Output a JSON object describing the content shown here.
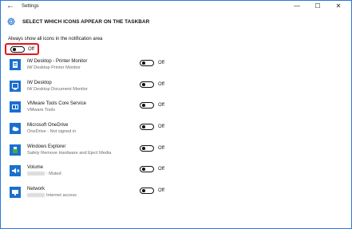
{
  "window": {
    "title": "Settings",
    "back_glyph": "←",
    "minimize_glyph": "—",
    "maximize_glyph": "☐",
    "close_glyph": "✕"
  },
  "page": {
    "title": "SELECT WHICH ICONS APPEAR ON THE TASKBAR",
    "title_icon": "gear-icon"
  },
  "always_show": {
    "label": "Always show all icons in the notification area",
    "state": "Off",
    "highlight_color": "#e2151e"
  },
  "items": [
    {
      "title": "iW Desktop - Printer Monitor",
      "subtitle": "iW Desktop Printer Monitor",
      "state": "Off",
      "icon": "printer-monitor-icon"
    },
    {
      "title": "iW Desktop",
      "subtitle": "iW Desktop Document Monitor",
      "state": "Off",
      "icon": "document-monitor-icon"
    },
    {
      "title": "VMware Tools Core Service",
      "subtitle": "VMware Tools",
      "state": "Off",
      "icon": "vmware-tools-icon"
    },
    {
      "title": "Microsoft OneDrive",
      "subtitle": "OneDrive - Not signed in",
      "state": "Off",
      "icon": "onedrive-cloud-icon"
    },
    {
      "title": "Windows Explorer",
      "subtitle": "Safely Remove Hardware and Eject Media",
      "state": "Off",
      "icon": "usb-eject-icon"
    },
    {
      "title": "Volume",
      "subtitle": ": Muted",
      "state": "Off",
      "icon": "volume-muted-icon"
    },
    {
      "title": "Network",
      "subtitle": "Internet access",
      "state": "Off",
      "icon": "network-icon"
    }
  ],
  "colors": {
    "accent": "#1a6fd0",
    "window_border": "#2b78d6"
  }
}
